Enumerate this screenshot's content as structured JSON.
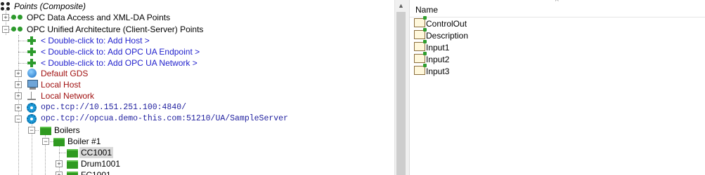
{
  "tree": {
    "root_label": "Points (Composite)",
    "opc_da": "OPC Data Access and XML-DA Points",
    "opc_ua": "OPC Unified Architecture (Client-Server) Points",
    "add_host": "< Double-click to: Add Host >",
    "add_endpoint": "< Double-click to: Add OPC UA Endpoint >",
    "add_network": "< Double-click to: Add OPC UA Network >",
    "default_gds": "Default GDS",
    "local_host": "Local Host",
    "local_network": "Local Network",
    "endpoint_1": "opc.tcp://10.151.251.100:4840/",
    "endpoint_2": "opc.tcp://opcua.demo-this.com:51210/UA/SampleServer",
    "boilers": "Boilers",
    "boiler1": "Boiler #1",
    "cc1001": "CC1001",
    "drum1001": "Drum1001",
    "fc1001": "FC1001"
  },
  "list": {
    "header": "Name",
    "items": [
      "ControlOut",
      "Description",
      "Input1",
      "Input2",
      "Input3"
    ]
  }
}
